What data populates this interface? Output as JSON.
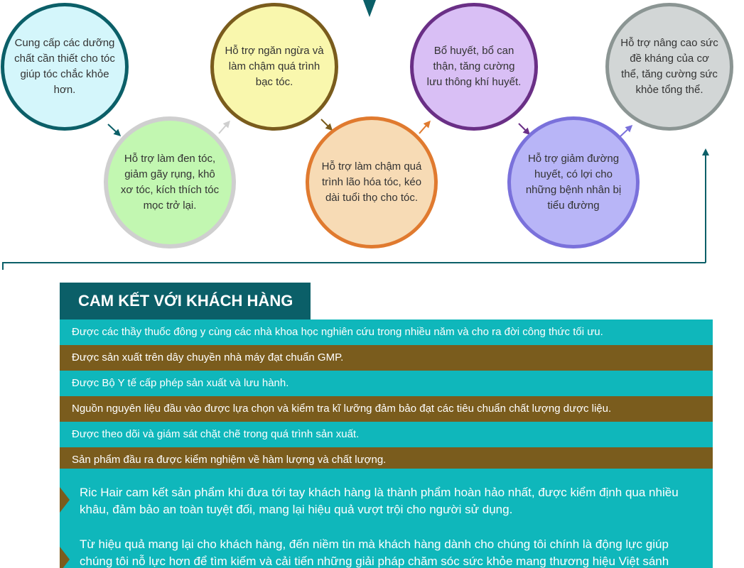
{
  "colors": {
    "teal_dark": "#0b5f68",
    "teal_light": "#0fb7bb",
    "brown": "#7a5c1d",
    "white": "#ffffff"
  },
  "benefits": [
    {
      "text": "Cung cấp các dưỡng chất cần thiết cho tóc giúp tóc chắc khỏe hơn.",
      "fill": "#d4f6fb",
      "ring": "#0b5f68"
    },
    {
      "text": "Hỗ trợ làm đen tóc, giảm gãy rụng, khô xơ tóc, kích thích tóc mọc trở lại.",
      "fill": "#c2f7b1",
      "ring": "#cfcfcf"
    },
    {
      "text": "Hỗ trợ ngăn ngừa và làm chậm quá trình bạc tóc.",
      "fill": "#f9f7ad",
      "ring": "#7a5c1d"
    },
    {
      "text": "Hỗ trợ làm chậm quá trình lão hóa tóc, kéo dài tuổi thọ cho tóc.",
      "fill": "#f7dbb5",
      "ring": "#e07a2f"
    },
    {
      "text": "Bổ huyết, bổ can thận, tăng cường lưu thông khí huyết.",
      "fill": "#d9bff5",
      "ring": "#6a2f86"
    },
    {
      "text": "Hỗ trợ giảm đường huyết, có lợi cho những bệnh nhân bị tiểu đường",
      "fill": "#b8b5f7",
      "ring": "#7a71db"
    },
    {
      "text": "Hỗ trợ nâng cao sức đề kháng của cơ thể, tăng cường sức khỏe tổng thể.",
      "fill": "#d2d6d6",
      "ring": "#8b9593"
    }
  ],
  "commitment": {
    "title": "CAM KẾT VỚI KHÁCH HÀNG",
    "items": [
      "Được các thầy thuốc đông y cùng các nhà khoa học nghiên cứu trong nhiều năm và cho ra đời công thức tối ưu.",
      "Được sản xuất trên dây chuyền nhà máy đạt chuẩn GMP.",
      "Được Bộ Y tế cấp phép sản xuất và lưu hành.",
      "Nguồn nguyên liệu đầu vào được lựa chọn và kiểm tra kĩ lưỡng đảm bảo đạt các tiêu chuẩn chất lượng dược liệu.",
      "Được theo dõi và giám sát chặt chẽ trong quá trình sản xuất.",
      "Sản phẩm đầu ra được kiểm nghiệm về hàm lượng và chất lượng."
    ],
    "paragraphs": [
      "Ric Hair cam kết sản phẩm khi đưa tới tay khách hàng là thành phẩm hoàn hảo nhất, được kiểm định qua nhiều khâu, đảm bảo an toàn tuyệt đối, mang lại hiệu quả vượt trội cho người sử dụng.",
      "Từ hiệu quả mang lại cho khách hàng, đến niềm tin mà khách hàng dành cho chúng tôi chính là động lực giúp chúng tôi nỗ lực hơn để tìm kiếm và cải tiến những giải pháp chăm sóc sức khỏe mang thương hiệu Việt sánh"
    ]
  }
}
